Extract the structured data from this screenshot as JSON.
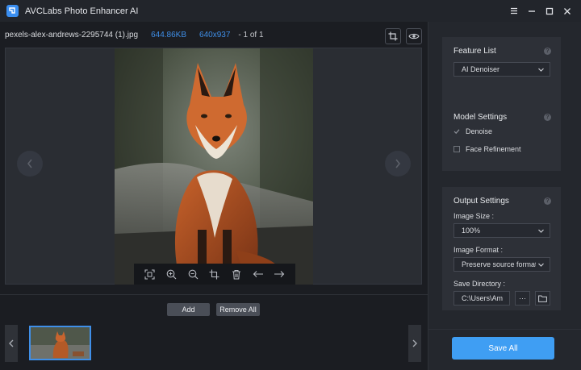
{
  "app": {
    "title": "AVCLabs Photo Enhancer AI"
  },
  "file": {
    "name": "pexels-alex-andrews-2295744 (1).jpg",
    "size": "644.86KB",
    "dimensions": "640x937",
    "page": "- 1 of 1"
  },
  "actions": {
    "add_label": "Add",
    "remove_all_label": "Remove All"
  },
  "feature_list": {
    "title": "Feature List",
    "selected": "AI Denoiser"
  },
  "model_settings": {
    "title": "Model Settings",
    "options": [
      {
        "label": "Denoise",
        "checked": true
      },
      {
        "label": "Face Refinement",
        "checked": false
      }
    ]
  },
  "output_settings": {
    "title": "Output Settings",
    "image_size_label": "Image Size :",
    "image_size_value": "100%",
    "image_format_label": "Image Format :",
    "image_format_value": "Preserve source format",
    "save_directory_label": "Save Directory :",
    "save_directory_value": "C:\\Users\\Am",
    "browse_label": "···"
  },
  "save_all_label": "Save All",
  "colors": {
    "accent": "#3f8fe8",
    "save_button": "#3f9ef3",
    "panel": "#2d3037"
  },
  "icons": [
    "app-logo-icon",
    "menu-icon",
    "minimize-icon",
    "maximize-icon",
    "close-icon",
    "crop-icon",
    "eye-icon",
    "fit-icon",
    "zoom-in-icon",
    "zoom-out-icon",
    "trash-icon",
    "arrow-left-icon",
    "arrow-right-icon",
    "chevron-left-icon",
    "chevron-right-icon",
    "folder-icon",
    "help-icon"
  ]
}
